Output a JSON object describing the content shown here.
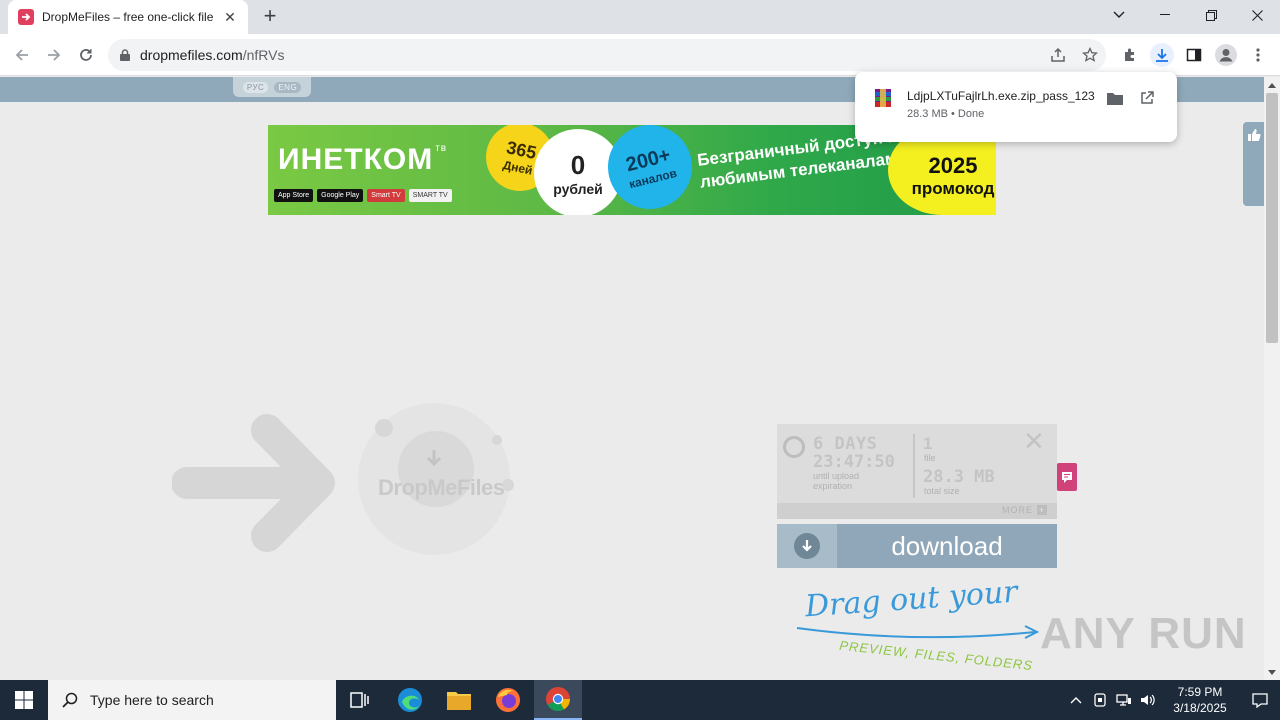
{
  "browser": {
    "tab_title": "DropMeFiles – free one-click file",
    "url_domain": "dropmefiles.com",
    "url_path": "/nfRVs"
  },
  "page": {
    "lang_ru": "РУС",
    "lang_en": "ENG",
    "banner": {
      "brand": "ИНЕТКОМ",
      "brand_suffix": "тв",
      "store_appstore": "App Store",
      "store_googleplay": "Google Play",
      "store_smarttv": "Smart TV",
      "store_samsung": "SMART TV",
      "days_value": "365",
      "days_label": "Дней",
      "price_value": "0",
      "price_label": "рублей",
      "channels_value": "200+",
      "channels_label": "каналов",
      "slogan": "Безграничный доступ к любимым телеканалам",
      "promo_year": "2025",
      "promo_label": "промокод"
    },
    "hero_logo": "DropMeFiles",
    "info": {
      "days": "6 DAYS",
      "time": "23:47:50",
      "expiry_caption": "until upload expiration",
      "files_count": "1",
      "files_label": "file",
      "total_size": "28.3 MB",
      "total_label": "total size",
      "more_label": "MORE"
    },
    "download_label": "download",
    "drag_line": "Drag out your",
    "drag_sub": "PREVIEW, FILES, FOLDERS",
    "watermark": "ANY RUN"
  },
  "download_bubble": {
    "filename": "LdjpLXTuFajlrLh.exe.zip_pass_123",
    "status": "28.3 MB • Done"
  },
  "taskbar": {
    "search_placeholder": "Type here to search",
    "time": "7:59 PM",
    "date": "3/18/2025"
  }
}
